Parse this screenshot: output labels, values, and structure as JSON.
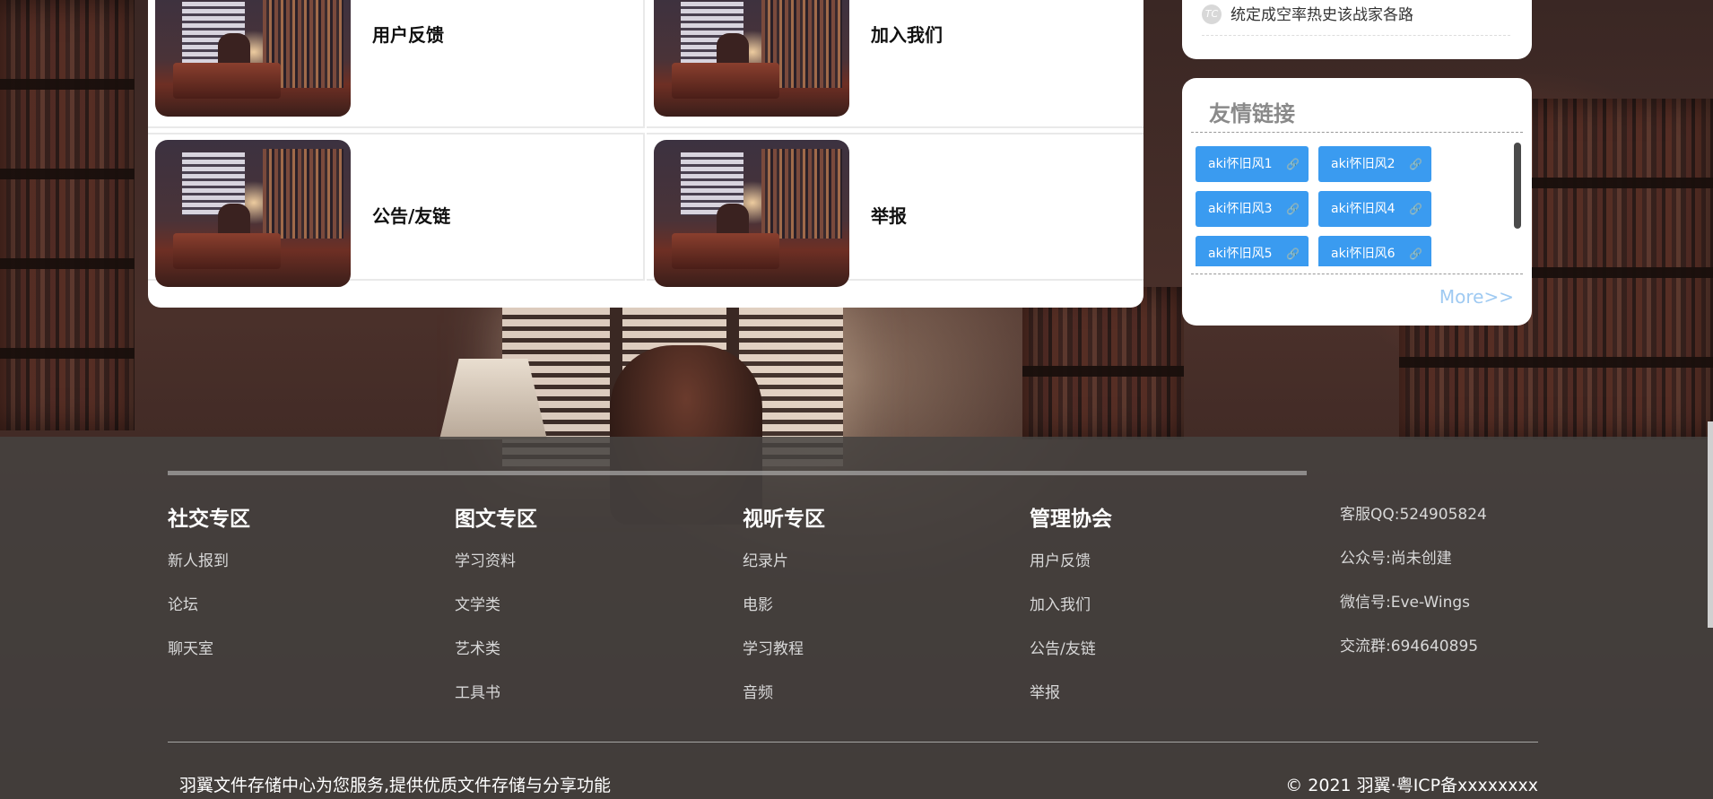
{
  "tiles": [
    {
      "title": "用户反馈"
    },
    {
      "title": "加入我们"
    },
    {
      "title": "公告/友链"
    },
    {
      "title": "举报"
    }
  ],
  "notice": {
    "badge": "TC",
    "text": "统定成空率热史该战家各路"
  },
  "friend_links": {
    "title": "友情链接",
    "items": [
      "aki怀旧风1",
      "aki怀旧风2",
      "aki怀旧风3",
      "aki怀旧风4",
      "aki怀旧风5",
      "aki怀旧风6"
    ],
    "more": "More>>",
    "tag_color": "#3a9bf0"
  },
  "footer": {
    "columns": [
      {
        "heading": "社交专区",
        "links": [
          "新人报到",
          "论坛",
          "聊天室"
        ]
      },
      {
        "heading": "图文专区",
        "links": [
          "学习资料",
          "文学类",
          "艺术类",
          "工具书"
        ]
      },
      {
        "heading": "视听专区",
        "links": [
          "纪录片",
          "电影",
          "学习教程",
          "音频"
        ]
      },
      {
        "heading": "管理协会",
        "links": [
          "用户反馈",
          "加入我们",
          "公告/友链",
          "举报"
        ]
      }
    ],
    "contact": [
      "客服QQ:524905824",
      "公众号:尚未创建",
      "微信号:Eve-Wings",
      "交流群:694640895"
    ],
    "description": "羽翼文件存储中心为您服务,提供优质文件存储与分享功能",
    "copyright": "© 2021 羽翼·粤ICP备xxxxxxxx"
  }
}
